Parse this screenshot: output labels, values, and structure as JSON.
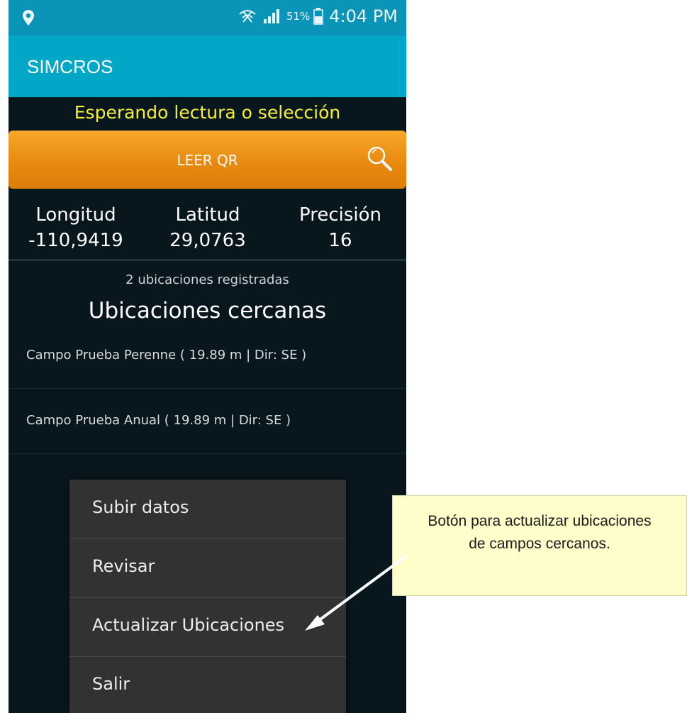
{
  "status_bar": {
    "location_icon": "location-pin-icon",
    "network_icon": "no-signal-icon",
    "signal_icon": "signal-bars-icon",
    "battery_percent": "51%",
    "battery_icon": "battery-icon",
    "time": "4:04 PM"
  },
  "app_bar": {
    "title": "SIMCROS"
  },
  "status_message": "Esperando lectura o selección",
  "qr_button": {
    "label": "LEER QR",
    "icon": "search-icon"
  },
  "coordinates": {
    "longitude_label": "Longitud",
    "longitude_value": "-110,9419",
    "latitude_label": "Latitud",
    "latitude_value": "29,0763",
    "precision_label": "Precisión",
    "precision_value": "16"
  },
  "locations": {
    "count_text": "2 ubicaciones registradas",
    "heading": "Ubicaciones cercanas",
    "items": [
      {
        "label": "Campo Prueba Perenne ( 19.89 m | Dir: SE )"
      },
      {
        "label": "Campo Prueba Anual ( 19.89 m | Dir: SE )"
      }
    ]
  },
  "menu": {
    "items": [
      {
        "label": "Subir datos"
      },
      {
        "label": "Revisar"
      },
      {
        "label": "Actualizar Ubicaciones"
      },
      {
        "label": "Salir"
      }
    ]
  },
  "callout": {
    "text": "Botón para actualizar ubicaciones de campos cercanos."
  },
  "colors": {
    "app_bar": "#00a7c7",
    "status_bar": "#0a94b7",
    "button": "#f19a1e",
    "status_text": "#f5ef38",
    "background": "#08161d",
    "callout": "#ffffcc"
  }
}
